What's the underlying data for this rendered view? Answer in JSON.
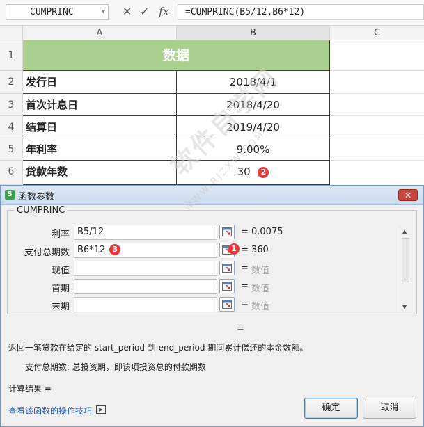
{
  "formula_bar": {
    "name_box": "CUMPRINC",
    "cancel_icon": "✕",
    "confirm_icon": "✓",
    "fx_label": "fx",
    "formula": "=CUMPRINC(B5/12,B6*12)"
  },
  "grid": {
    "columns": [
      "A",
      "B",
      "C"
    ],
    "rows": [
      "1",
      "2",
      "3",
      "4",
      "5",
      "6"
    ],
    "header_cell": "数据",
    "cells": [
      {
        "label": "发行日",
        "value": "2018/4/1"
      },
      {
        "label": "首次计息日",
        "value": "2018/4/20"
      },
      {
        "label": "结算日",
        "value": "2019/4/20"
      },
      {
        "label": "年利率",
        "value": "9.00%"
      },
      {
        "label": "贷款年数",
        "value": "30"
      }
    ],
    "header_color": "#a9d08e"
  },
  "badges": {
    "b1": "1",
    "b2": "2",
    "b3": "3"
  },
  "dialog": {
    "title": "函数参数",
    "app_icon": "S",
    "close_icon": "✕",
    "function_name": "CUMPRINC",
    "args": [
      {
        "label": "利率",
        "input": "B5/12",
        "eq": "=",
        "value": "0.0075"
      },
      {
        "label": "支付总期数",
        "input": "B6*12",
        "eq": "=",
        "value": "360"
      },
      {
        "label": "现值",
        "input": "",
        "eq": "=",
        "value": "数值"
      },
      {
        "label": "首期",
        "input": "",
        "eq": "=",
        "value": "数值"
      },
      {
        "label": "末期",
        "input": "",
        "eq": "=",
        "value": "数值"
      }
    ],
    "result_eq": "=",
    "description": "返回一笔贷款在给定的 start_period 到 end_period 期间累计偿还的本金数额。",
    "param_description": "支付总期数:  总投资期，即该项投资总的付款期数",
    "calc_result": "计算结果  =",
    "help_link": "查看该函数的操作技巧",
    "ok_label": "确定",
    "cancel_label": "取消"
  },
  "watermark": {
    "text": "软件自学网",
    "sub": "WWW.RJZXW.COM"
  }
}
